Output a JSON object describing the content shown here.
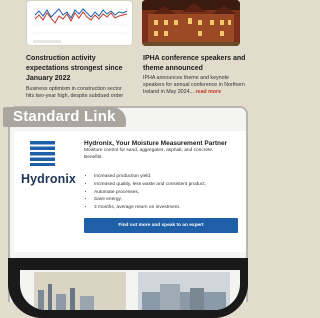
{
  "articles": [
    {
      "title_lines": [
        "Construction activity",
        "expectations strongest since",
        "January 2022"
      ],
      "body_lines": [
        "Business optimism in construction sector",
        "hits two-year high, despite subdued order"
      ]
    },
    {
      "title_lines": [
        "IPHA conference speakers and",
        "theme announced"
      ],
      "body_lines": [
        "IPHA announces theme and keynote",
        "speakers for annual conference in Northern",
        "Ireland in May 2024..."
      ],
      "read_more": "read more"
    }
  ],
  "section_label": "Standard Link",
  "ad": {
    "logo_text": "Hydronix",
    "heading": "Hydronix, Your Moisture Measurement Partner",
    "description_lines": [
      "Moisture control for sand, aggregates, asphalt, and concrete.",
      "Benefits:"
    ],
    "benefits": [
      "Increased production yield,",
      "Increased quality, less waste and consistent product,",
      "Automate processes,",
      "Save energy,",
      "3 months, average return on investment."
    ],
    "cta_label": "Find out more and speak to an expert"
  },
  "colors": {
    "background": "#e1dccb",
    "panel_tab": "#a9a6a0",
    "cta_blue": "#1f5fa8",
    "logo_blue": "#1d3557",
    "link_red": "#c0392b"
  }
}
